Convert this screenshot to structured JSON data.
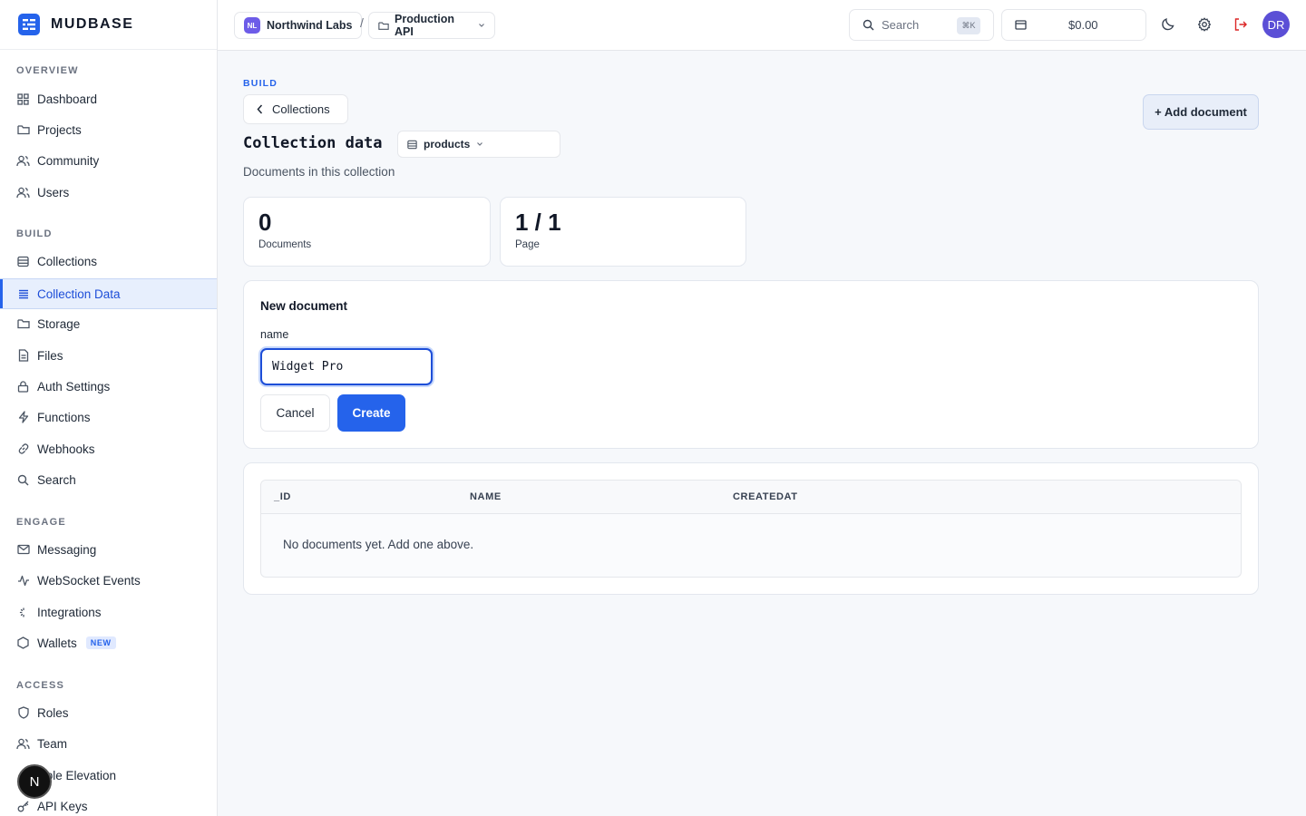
{
  "brand": {
    "name": "MUDBASE"
  },
  "sidebar": {
    "sections": [
      {
        "title": "OVERVIEW",
        "items": [
          {
            "label": "Dashboard",
            "icon": "grid-icon"
          },
          {
            "label": "Projects",
            "icon": "folder-icon"
          },
          {
            "label": "Community",
            "icon": "users-icon"
          },
          {
            "label": "Users",
            "icon": "users-icon"
          }
        ]
      },
      {
        "title": "BUILD",
        "items": [
          {
            "label": "Collections",
            "icon": "database-icon"
          },
          {
            "label": "Collection Data",
            "icon": "list-icon",
            "active": true
          },
          {
            "label": "Storage",
            "icon": "folder-icon"
          },
          {
            "label": "Files",
            "icon": "file-icon"
          },
          {
            "label": "Auth Settings",
            "icon": "lock-icon"
          },
          {
            "label": "Functions",
            "icon": "bolt-icon"
          },
          {
            "label": "Webhooks",
            "icon": "link-icon"
          },
          {
            "label": "Search",
            "icon": "search-icon"
          }
        ]
      },
      {
        "title": "ENGAGE",
        "items": [
          {
            "label": "Messaging",
            "icon": "mail-icon"
          },
          {
            "label": "WebSocket Events",
            "icon": "activity-icon"
          },
          {
            "label": "Integrations",
            "icon": "sparkle-icon"
          },
          {
            "label": "Wallets",
            "icon": "hexagon-icon",
            "badge": "NEW"
          }
        ]
      },
      {
        "title": "ACCESS",
        "items": [
          {
            "label": "Roles",
            "icon": "shield-icon"
          },
          {
            "label": "Team",
            "icon": "users-icon"
          },
          {
            "label": "Role Elevation",
            "icon": "arrow-icon"
          },
          {
            "label": "API Keys",
            "icon": "key-icon"
          }
        ]
      }
    ],
    "fab_label": "N"
  },
  "topbar": {
    "org": {
      "badge": "NL",
      "name": "Northwind Labs"
    },
    "separator": "/",
    "project": {
      "name": "Production API"
    },
    "search": {
      "placeholder": "Search",
      "shortcut": "⌘K"
    },
    "credits": "$0.00",
    "avatar": "DR"
  },
  "main": {
    "kicker": "BUILD",
    "back_label": "Collections",
    "title": "Collection data",
    "collection_select": "products",
    "subtitle": "Documents in this collection",
    "add_button": "+ Add document",
    "stats": [
      {
        "value": "0",
        "label": "Documents"
      },
      {
        "value": "1 / 1",
        "label": "Page"
      }
    ],
    "form": {
      "title": "New document",
      "field_label": "name",
      "field_value": "Widget Pro",
      "cancel": "Cancel",
      "create": "Create"
    },
    "table": {
      "columns": [
        "_ID",
        "NAME",
        "CREATEDAT"
      ],
      "empty_text": "No documents yet. Add one above."
    }
  },
  "colors": {
    "accent": "#2563eb",
    "active_bg": "#e7effd",
    "background": "#f6f8fb"
  }
}
